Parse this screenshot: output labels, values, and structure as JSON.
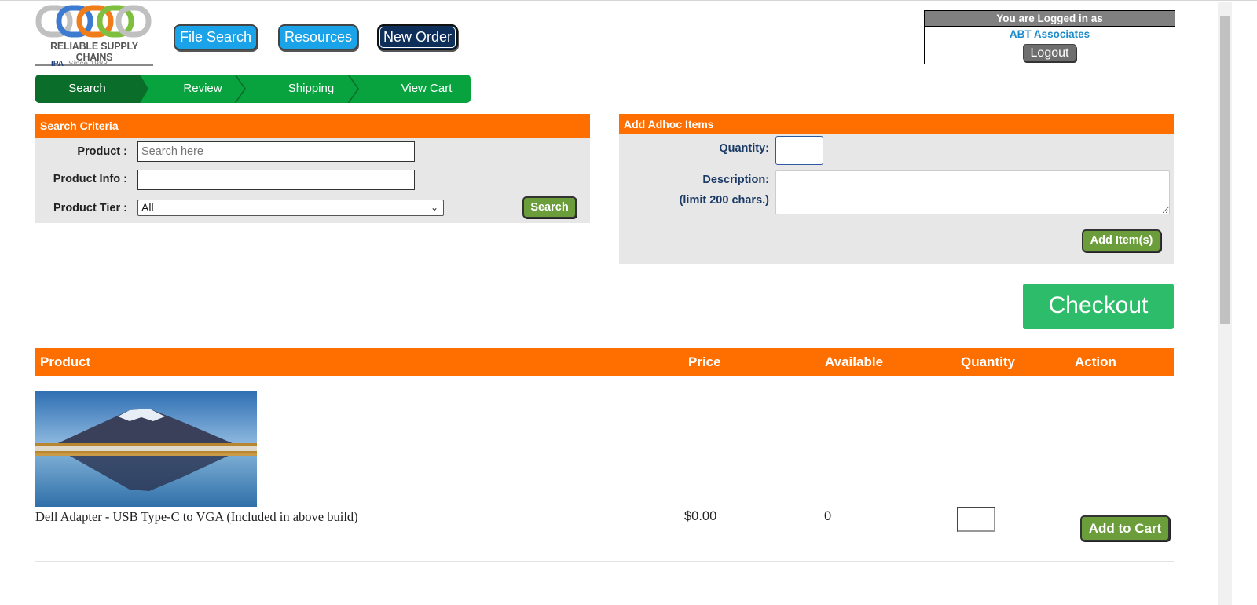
{
  "logo": {
    "name": "RELIABLE SUPPLY CHAINS",
    "formerly": "IPA",
    "since": "Since 1983"
  },
  "nav": {
    "file_search": "File Search",
    "resources": "Resources",
    "new_order": "New Order"
  },
  "login": {
    "header": "You are Logged in as",
    "user": "ABT Associates",
    "logout": "Logout"
  },
  "steps": [
    "Search",
    "Review",
    "Shipping",
    "View Cart"
  ],
  "search_criteria": {
    "title": "Search Criteria",
    "product_label": "Product :",
    "product_placeholder": "Search here",
    "product_info_label": "Product Info :",
    "product_info_value": "",
    "tier_label": "Product Tier :",
    "tier_selected": "All",
    "search_button": "Search"
  },
  "adhoc": {
    "title": "Add Adhoc Items",
    "quantity_label": "Quantity:",
    "description_label": "Description:",
    "limit_label": "(limit 200 chars.)",
    "add_button": "Add Item(s)"
  },
  "checkout": "Checkout",
  "table": {
    "headers": {
      "product": "Product",
      "price": "Price",
      "available": "Available",
      "quantity": "Quantity",
      "action": "Action"
    },
    "rows": [
      {
        "name": "Dell Adapter - USB Type-C to VGA (Included in above build)",
        "price": "$0.00",
        "available": "0",
        "action": "Add to Cart"
      }
    ]
  },
  "colors": {
    "orange": "#ff6f00",
    "green_steps": "#08a33f",
    "checkout_green": "#2dbc6a",
    "nav_blue": "#1aa3e8",
    "nav_dark": "#0d2f5a"
  }
}
